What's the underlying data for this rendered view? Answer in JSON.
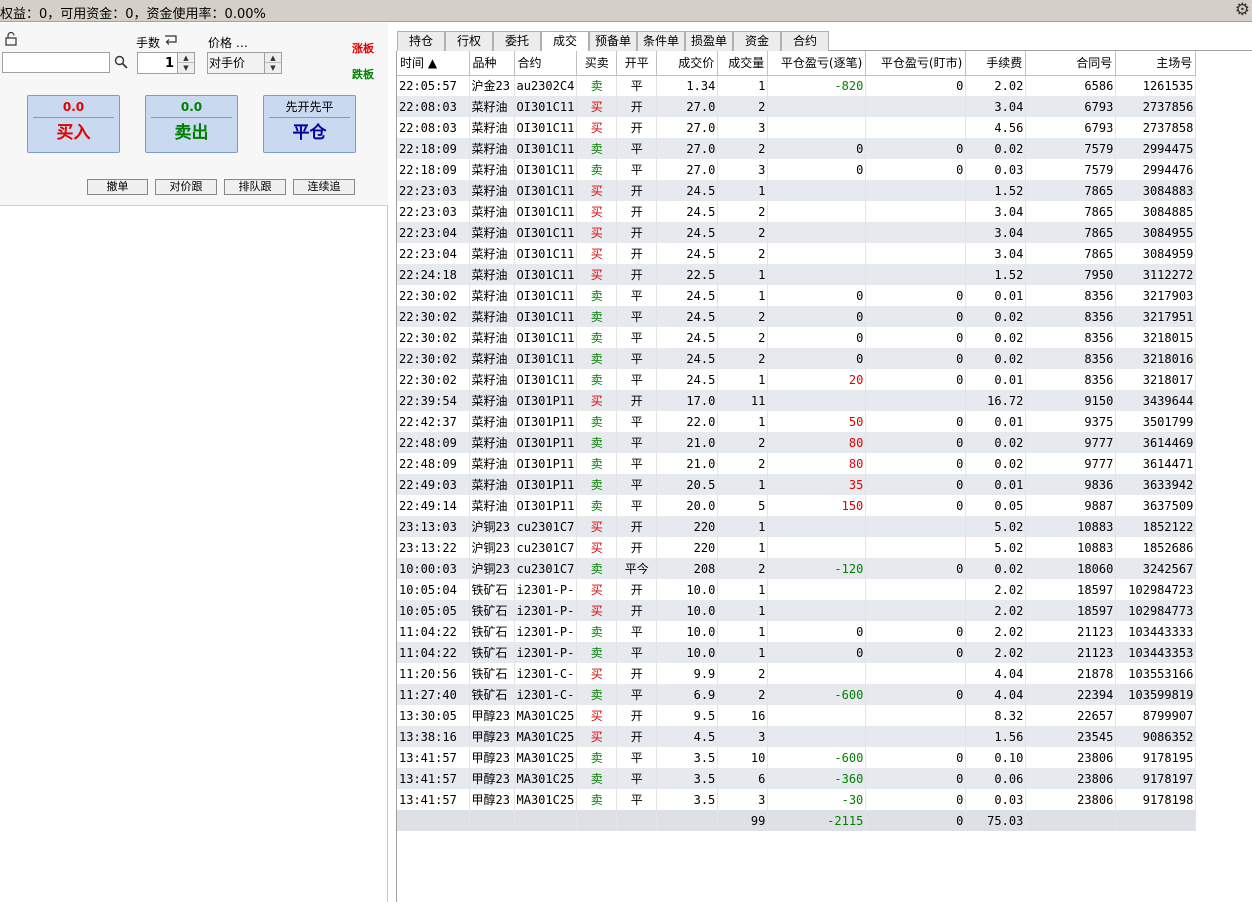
{
  "status_bar": {
    "text": "权益：0，可用资金：0，资金使用率：0.00%"
  },
  "order_panel": {
    "code_value": "",
    "qty_label": "手数",
    "qty_value": "1",
    "price_label": "价格 …",
    "price_value": "对手价",
    "limit_up": "涨板",
    "limit_down": "跌板",
    "buy": {
      "price": "0.0",
      "label": "买入"
    },
    "sell": {
      "price": "0.0",
      "label": "卖出"
    },
    "close": {
      "top": "先开先平",
      "label": "平仓"
    },
    "small_buttons": [
      "撤单",
      "对价跟",
      "排队跟",
      "连续追"
    ]
  },
  "tabs": [
    "持仓",
    "行权",
    "委托",
    "成交",
    "预备单",
    "条件单",
    "损盈单",
    "资金",
    "合约"
  ],
  "active_tab": "成交",
  "table": {
    "headers": [
      "时间 ▲",
      "品种",
      "合约",
      "买卖",
      "开平",
      "成交价",
      "成交量",
      "平仓盈亏(逐笔)",
      "平仓盈亏(盯市)",
      "手续费",
      "合同号",
      "主场号"
    ],
    "rows": [
      [
        "22:05:57",
        "沪金23",
        "au2302C4",
        "卖",
        "平",
        "1.34",
        "1",
        "-820",
        "0",
        "2.02",
        "6586",
        "1261535"
      ],
      [
        "22:08:03",
        "菜籽油",
        "OI301C11",
        "买",
        "开",
        "27.0",
        "2",
        "",
        "",
        "3.04",
        "6793",
        "2737856"
      ],
      [
        "22:08:03",
        "菜籽油",
        "OI301C11",
        "买",
        "开",
        "27.0",
        "3",
        "",
        "",
        "4.56",
        "6793",
        "2737858"
      ],
      [
        "22:18:09",
        "菜籽油",
        "OI301C11",
        "卖",
        "平",
        "27.0",
        "2",
        "0",
        "0",
        "0.02",
        "7579",
        "2994475"
      ],
      [
        "22:18:09",
        "菜籽油",
        "OI301C11",
        "卖",
        "平",
        "27.0",
        "3",
        "0",
        "0",
        "0.03",
        "7579",
        "2994476"
      ],
      [
        "22:23:03",
        "菜籽油",
        "OI301C11",
        "买",
        "开",
        "24.5",
        "1",
        "",
        "",
        "1.52",
        "7865",
        "3084883"
      ],
      [
        "22:23:03",
        "菜籽油",
        "OI301C11",
        "买",
        "开",
        "24.5",
        "2",
        "",
        "",
        "3.04",
        "7865",
        "3084885"
      ],
      [
        "22:23:04",
        "菜籽油",
        "OI301C11",
        "买",
        "开",
        "24.5",
        "2",
        "",
        "",
        "3.04",
        "7865",
        "3084955"
      ],
      [
        "22:23:04",
        "菜籽油",
        "OI301C11",
        "买",
        "开",
        "24.5",
        "2",
        "",
        "",
        "3.04",
        "7865",
        "3084959"
      ],
      [
        "22:24:18",
        "菜籽油",
        "OI301C11",
        "买",
        "开",
        "22.5",
        "1",
        "",
        "",
        "1.52",
        "7950",
        "3112272"
      ],
      [
        "22:30:02",
        "菜籽油",
        "OI301C11",
        "卖",
        "平",
        "24.5",
        "1",
        "0",
        "0",
        "0.01",
        "8356",
        "3217903"
      ],
      [
        "22:30:02",
        "菜籽油",
        "OI301C11",
        "卖",
        "平",
        "24.5",
        "2",
        "0",
        "0",
        "0.02",
        "8356",
        "3217951"
      ],
      [
        "22:30:02",
        "菜籽油",
        "OI301C11",
        "卖",
        "平",
        "24.5",
        "2",
        "0",
        "0",
        "0.02",
        "8356",
        "3218015"
      ],
      [
        "22:30:02",
        "菜籽油",
        "OI301C11",
        "卖",
        "平",
        "24.5",
        "2",
        "0",
        "0",
        "0.02",
        "8356",
        "3218016"
      ],
      [
        "22:30:02",
        "菜籽油",
        "OI301C11",
        "卖",
        "平",
        "24.5",
        "1",
        "20",
        "0",
        "0.01",
        "8356",
        "3218017"
      ],
      [
        "22:39:54",
        "菜籽油",
        "OI301P11",
        "买",
        "开",
        "17.0",
        "11",
        "",
        "",
        "16.72",
        "9150",
        "3439644"
      ],
      [
        "22:42:37",
        "菜籽油",
        "OI301P11",
        "卖",
        "平",
        "22.0",
        "1",
        "50",
        "0",
        "0.01",
        "9375",
        "3501799"
      ],
      [
        "22:48:09",
        "菜籽油",
        "OI301P11",
        "卖",
        "平",
        "21.0",
        "2",
        "80",
        "0",
        "0.02",
        "9777",
        "3614469"
      ],
      [
        "22:48:09",
        "菜籽油",
        "OI301P11",
        "卖",
        "平",
        "21.0",
        "2",
        "80",
        "0",
        "0.02",
        "9777",
        "3614471"
      ],
      [
        "22:49:03",
        "菜籽油",
        "OI301P11",
        "卖",
        "平",
        "20.5",
        "1",
        "35",
        "0",
        "0.01",
        "9836",
        "3633942"
      ],
      [
        "22:49:14",
        "菜籽油",
        "OI301P11",
        "卖",
        "平",
        "20.0",
        "5",
        "150",
        "0",
        "0.05",
        "9887",
        "3637509"
      ],
      [
        "23:13:03",
        "沪铜23",
        "cu2301C7",
        "买",
        "开",
        "220",
        "1",
        "",
        "",
        "5.02",
        "10883",
        "1852122"
      ],
      [
        "23:13:22",
        "沪铜23",
        "cu2301C7",
        "买",
        "开",
        "220",
        "1",
        "",
        "",
        "5.02",
        "10883",
        "1852686"
      ],
      [
        "10:00:03",
        "沪铜23",
        "cu2301C7",
        "卖",
        "平今",
        "208",
        "2",
        "-120",
        "0",
        "0.02",
        "18060",
        "3242567"
      ],
      [
        "10:05:04",
        "铁矿石",
        "i2301-P-",
        "买",
        "开",
        "10.0",
        "1",
        "",
        "",
        "2.02",
        "18597",
        "102984723"
      ],
      [
        "10:05:05",
        "铁矿石",
        "i2301-P-",
        "买",
        "开",
        "10.0",
        "1",
        "",
        "",
        "2.02",
        "18597",
        "102984773"
      ],
      [
        "11:04:22",
        "铁矿石",
        "i2301-P-",
        "卖",
        "平",
        "10.0",
        "1",
        "0",
        "0",
        "2.02",
        "21123",
        "103443333"
      ],
      [
        "11:04:22",
        "铁矿石",
        "i2301-P-",
        "卖",
        "平",
        "10.0",
        "1",
        "0",
        "0",
        "2.02",
        "21123",
        "103443353"
      ],
      [
        "11:20:56",
        "铁矿石",
        "i2301-C-",
        "买",
        "开",
        "9.9",
        "2",
        "",
        "",
        "4.04",
        "21878",
        "103553166"
      ],
      [
        "11:27:40",
        "铁矿石",
        "i2301-C-",
        "卖",
        "平",
        "6.9",
        "2",
        "-600",
        "0",
        "4.04",
        "22394",
        "103599819"
      ],
      [
        "13:30:05",
        "甲醇23",
        "MA301C25",
        "买",
        "开",
        "9.5",
        "16",
        "",
        "",
        "8.32",
        "22657",
        "8799907"
      ],
      [
        "13:38:16",
        "甲醇23",
        "MA301C25",
        "买",
        "开",
        "4.5",
        "3",
        "",
        "",
        "1.56",
        "23545",
        "9086352"
      ],
      [
        "13:41:57",
        "甲醇23",
        "MA301C25",
        "卖",
        "平",
        "3.5",
        "10",
        "-600",
        "0",
        "0.10",
        "23806",
        "9178195"
      ],
      [
        "13:41:57",
        "甲醇23",
        "MA301C25",
        "卖",
        "平",
        "3.5",
        "6",
        "-360",
        "0",
        "0.06",
        "23806",
        "9178197"
      ],
      [
        "13:41:57",
        "甲醇23",
        "MA301C25",
        "卖",
        "平",
        "3.5",
        "3",
        "-30",
        "0",
        "0.03",
        "23806",
        "9178198"
      ]
    ],
    "summary": [
      "",
      "",
      "",
      "",
      "",
      "",
      "99",
      "-2115",
      "0",
      "75.03",
      "",
      ""
    ]
  },
  "colors": {
    "buy": "#e00000",
    "sell": "#008000",
    "profit": "#e00000",
    "loss": "#008000",
    "row_alt": "#e6e9ee"
  },
  "icons": {
    "lock": "lock-icon",
    "search": "search-icon",
    "qty": "return-icon",
    "gear": "gear-icon"
  }
}
